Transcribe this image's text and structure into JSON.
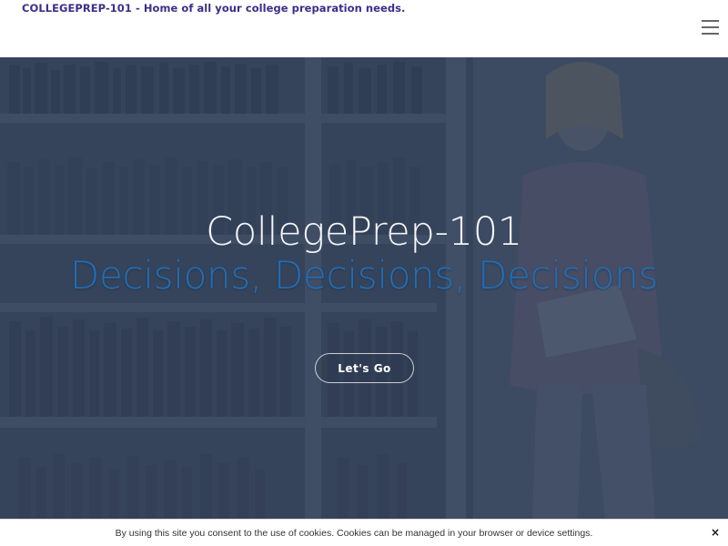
{
  "header": {
    "site_title": "COLLEGEPREP-101 - Home of all your college preparation needs.",
    "menu_icon": "hamburger-menu-icon"
  },
  "hero": {
    "title": "CollegePrep-101",
    "subtitle": "Decisions, Decisions, Decisions",
    "cta_label": "Let's Go"
  },
  "cookie_bar": {
    "text": "By using this site you consent to the use of cookies. Cookies can be managed in your browser or device settings.",
    "close_label": "×",
    "close_icon": "close-icon"
  },
  "colors": {
    "site_title": "#3d2e8a",
    "hero_subtitle": "#1e6fba",
    "hero_bg": "#3b4960"
  }
}
